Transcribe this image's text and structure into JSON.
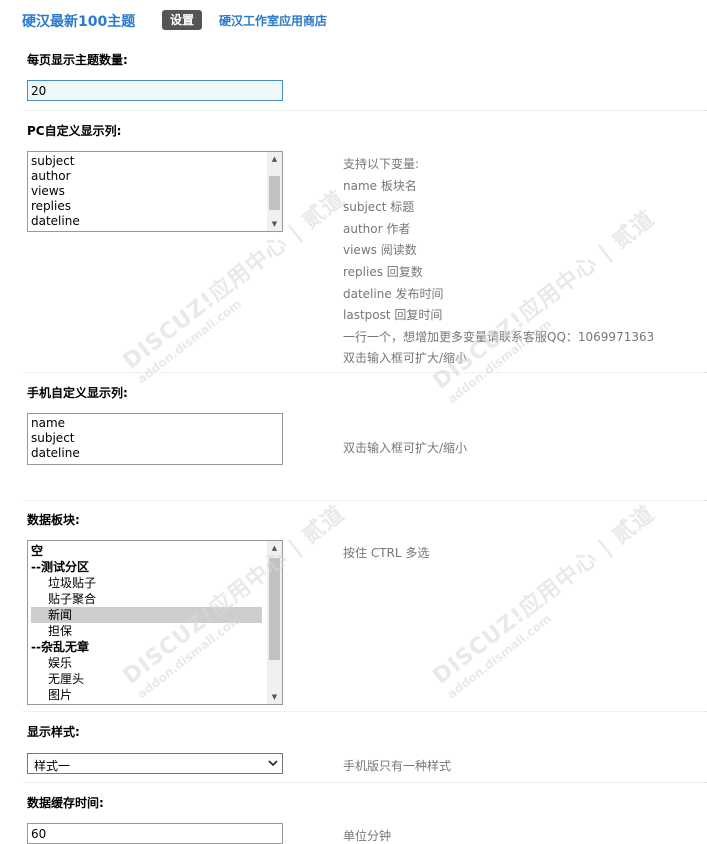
{
  "header": {
    "app_title": "硬汉最新100主题",
    "settings_tab": "设置",
    "store_link": "硬汉工作室应用商店"
  },
  "per_page": {
    "label": "每页显示主题数量:",
    "value": "20"
  },
  "pc_columns": {
    "label": "PC自定义显示列:",
    "lines": [
      "subject",
      "author",
      "views",
      "replies",
      "dateline"
    ],
    "hints": [
      "支持以下变量:",
      "name 板块名",
      "subject 标题",
      "author 作者",
      "views 阅读数",
      "replies 回复数",
      "dateline 发布时间",
      "lastpost 回复时间",
      "一行一个，想增加更多变量请联系客服QQ：1069971363",
      "双击输入框可扩大/缩小"
    ]
  },
  "mobile_columns": {
    "label": "手机自定义显示列:",
    "lines": [
      "name",
      "subject",
      "dateline"
    ],
    "hint": "双击输入框可扩大/缩小"
  },
  "forums": {
    "label": "数据板块:",
    "hint": "按住 CTRL 多选",
    "options": [
      {
        "text": "空",
        "group": true
      },
      {
        "text": "--测试分区",
        "group": true
      },
      {
        "text": "垃圾贴子",
        "group": false
      },
      {
        "text": "贴子聚合",
        "group": false
      },
      {
        "text": "新闻",
        "group": false,
        "selected": true
      },
      {
        "text": "担保",
        "group": false
      },
      {
        "text": "--杂乱无章",
        "group": true
      },
      {
        "text": "娱乐",
        "group": false
      },
      {
        "text": "无厘头",
        "group": false
      },
      {
        "text": "图片",
        "group": false
      }
    ]
  },
  "style": {
    "label": "显示样式:",
    "value": "样式一",
    "hint": "手机版只有一种样式"
  },
  "cache": {
    "label": "数据缓存时间:",
    "value": "60",
    "hint": "单位分钟"
  },
  "watermark": {
    "main": "DISCUZ!应用中心 | 贰道",
    "sub": "addon.dismall.com"
  }
}
